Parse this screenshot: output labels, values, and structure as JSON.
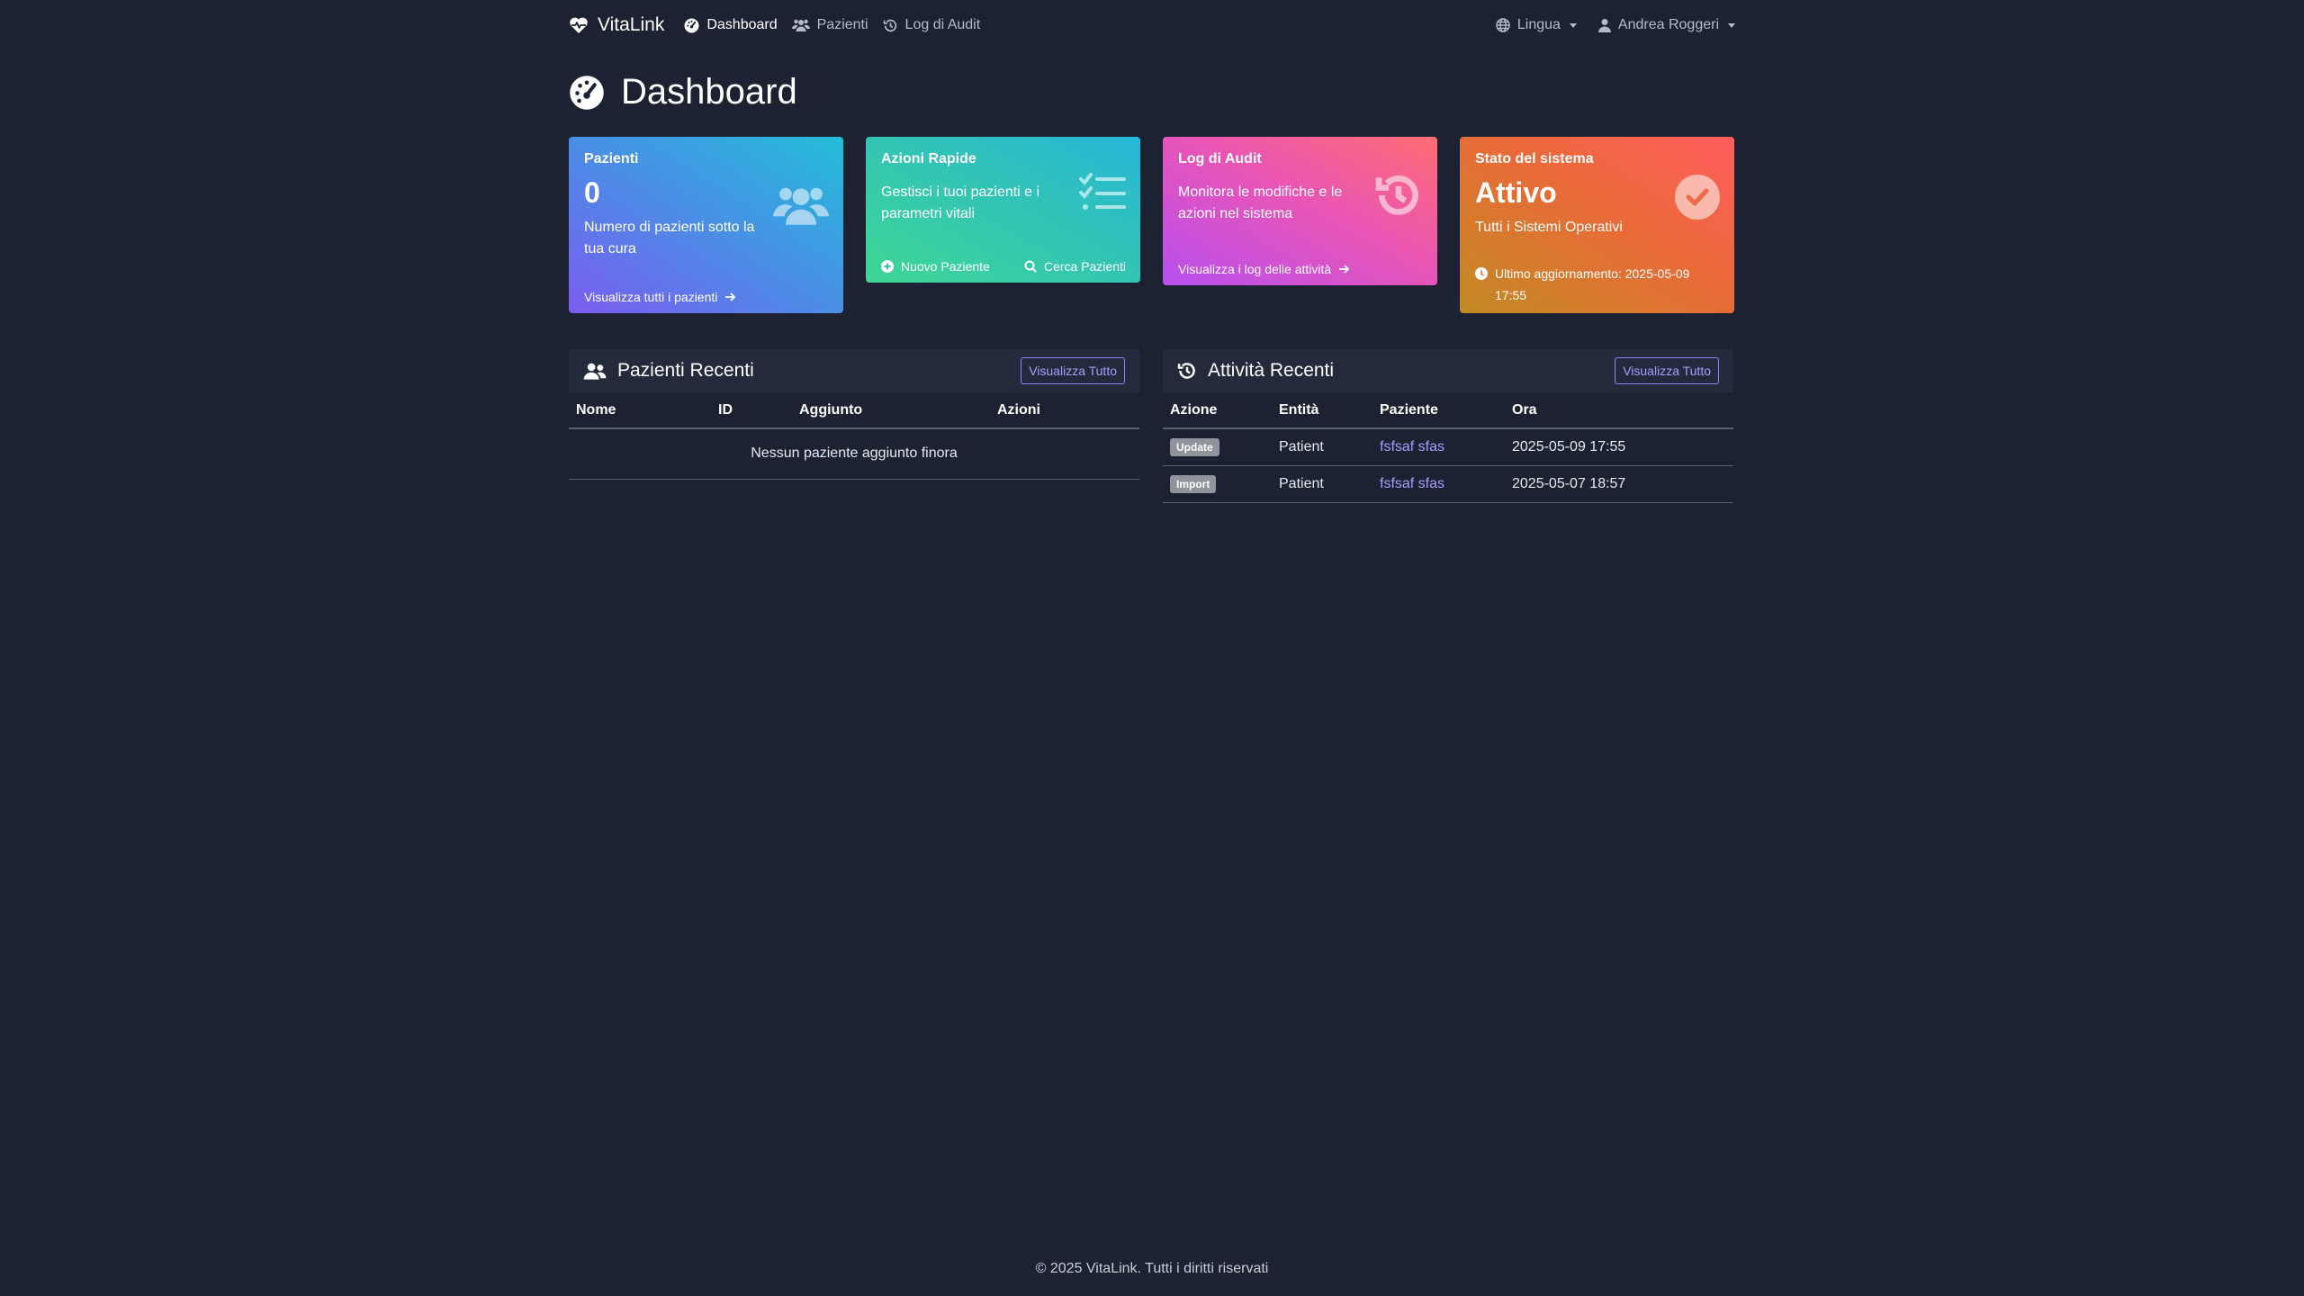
{
  "nav": {
    "brand": "VitaLink",
    "links": [
      "Dashboard",
      "Pazienti",
      "Log di Audit"
    ],
    "language": "Lingua",
    "user": "Andrea Roggeri"
  },
  "page": {
    "title": "Dashboard"
  },
  "cards": {
    "patients": {
      "label": "Pazienti",
      "count": "0",
      "text": "Numero di pazienti sotto la tua cura",
      "link": "Visualizza tutti i pazienti",
      "gradient": [
        "#7b5cf0",
        "#22bed8"
      ]
    },
    "quick": {
      "label": "Azioni Rapide",
      "text": "Gestisci i tuoi pazienti e i parametri vitali",
      "new_patient": "Nuovo Paziente",
      "search": "Cerca Pazienti",
      "gradient": [
        "#3fd694",
        "#26b8d9"
      ]
    },
    "audit": {
      "label": "Log di Audit",
      "text": "Monitora le modifiche e le azioni nel sistema",
      "link": "Visualizza i log delle attività",
      "gradient": [
        "#b84ff0",
        "#ff6d72"
      ]
    },
    "status": {
      "label": "Stato del sistema",
      "value": "Attivo",
      "text": "Tutti i Sistemi Operativi",
      "updated": "Ultimo aggiornamento: 2025-05-09 17:55",
      "gradient": [
        "#c28a23",
        "#ff5d5d"
      ]
    }
  },
  "recent_patients": {
    "title": "Pazienti Recenti",
    "button": "Visualizza Tutto",
    "columns": [
      "Nome",
      "ID",
      "Aggiunto",
      "Azioni"
    ],
    "empty": "Nessun paziente aggiunto finora"
  },
  "recent_activity": {
    "title": "Attività Recenti",
    "button": "Visualizza Tutto",
    "columns": [
      "Azione",
      "Entità",
      "Paziente",
      "Ora"
    ],
    "rows": [
      {
        "action": "Update",
        "entity": "Patient",
        "patient": "fsfsaf sfas",
        "time": "2025-05-09 17:55"
      },
      {
        "action": "Import",
        "entity": "Patient",
        "patient": "fsfsaf sfas",
        "time": "2025-05-07 18:57"
      }
    ]
  },
  "footer": "© 2025 VitaLink. Tutti i diritti riservati",
  "colors": {
    "background": "#1c2231",
    "panel": "#232a3b",
    "accent": "#a79cff"
  }
}
